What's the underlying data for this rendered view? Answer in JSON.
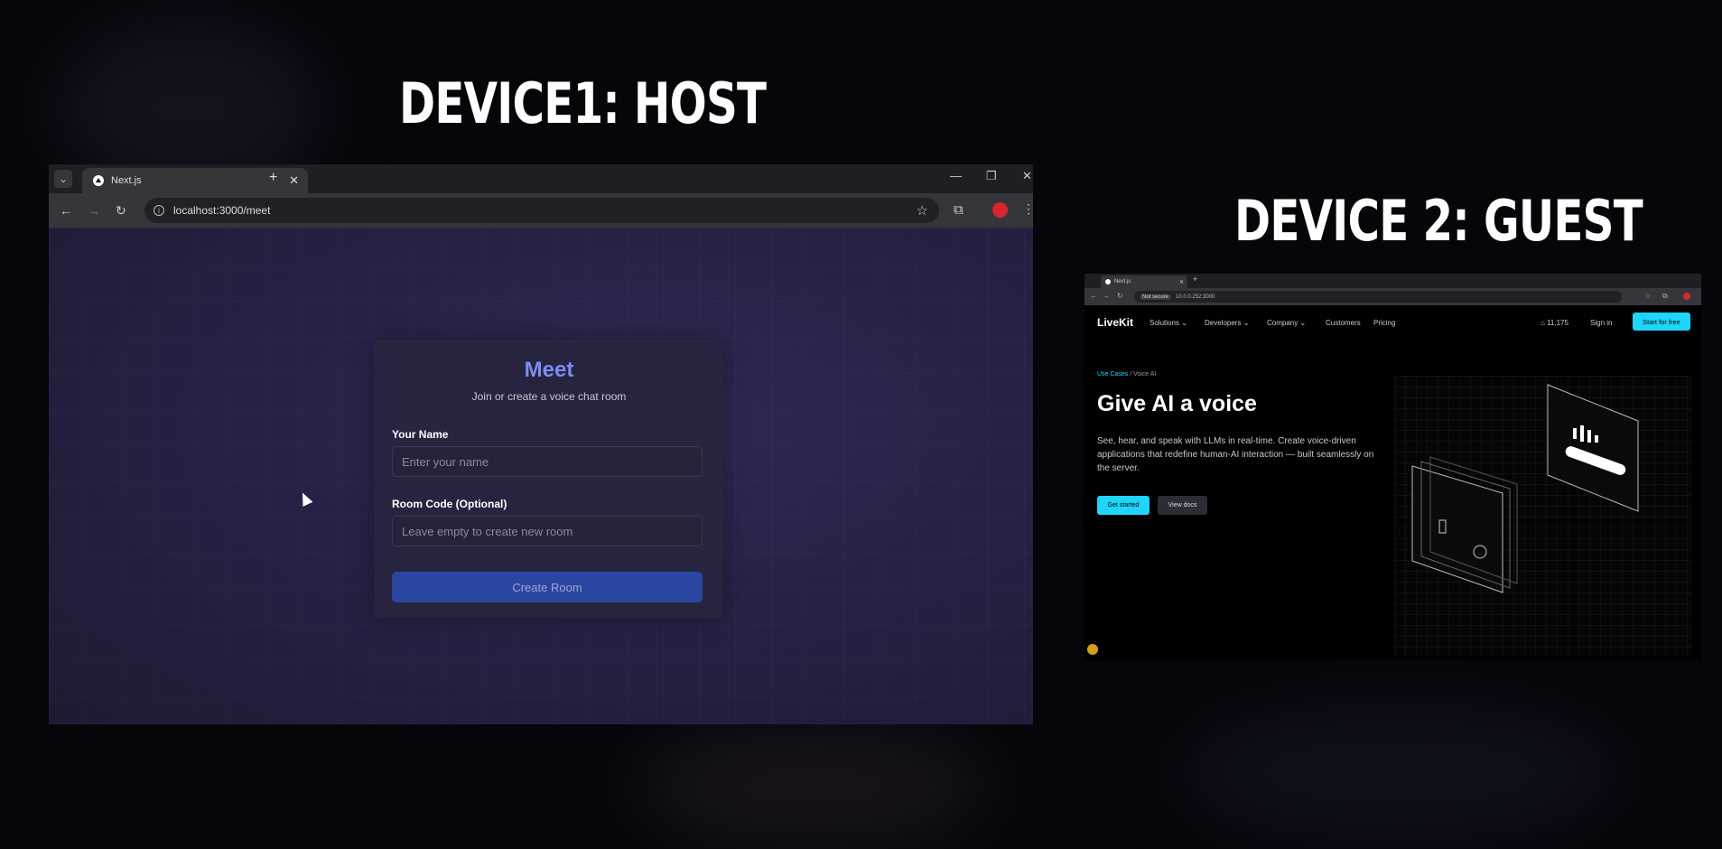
{
  "headings": {
    "device1_prefix": "DEVICE1:",
    "device1_role": "HOST",
    "device2_prefix": "DEVICE 2:",
    "device2_role": "GUEST"
  },
  "device1": {
    "tab_title": "Next.js",
    "url": "localhost:3000/meet",
    "meet": {
      "title": "Meet",
      "subtitle": "Join or create a voice chat room",
      "name_label": "Your Name",
      "name_placeholder": "Enter your name",
      "room_label": "Room Code (Optional)",
      "room_placeholder": "Leave empty to create new room",
      "create_button": "Create Room"
    }
  },
  "device2": {
    "tab_title": "Next.js",
    "security": "Not secure",
    "url": "10.0.0.252:3000",
    "livekit": {
      "logo": "LiveKit",
      "nav": [
        "Solutions",
        "Developers",
        "Company",
        "Customers",
        "Pricing"
      ],
      "stars": "11,175",
      "sign_in": "Sign in",
      "start_free": "Start for free",
      "breadcrumb_1": "Use Cases",
      "breadcrumb_2": "Voice AI",
      "hero_title": "Give AI a voice",
      "hero_desc": "See, hear, and speak with LLMs in real-time. Create voice-driven applications that redefine human-AI interaction — built seamlessly on the server.",
      "get_started": "Get started",
      "view_docs": "View docs"
    }
  },
  "colors": {
    "meet_accent": "#7c8cf0",
    "create_button": "#2b46a0",
    "livekit_cyan": "#1fd5f9"
  }
}
